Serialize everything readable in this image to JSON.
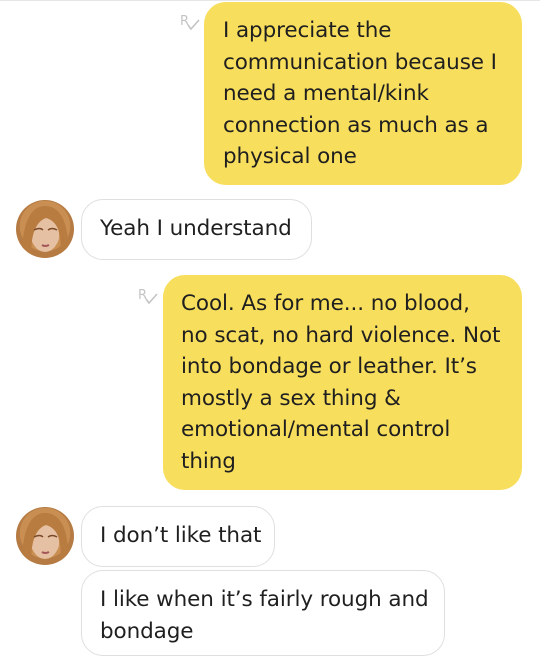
{
  "conversation": {
    "messages": [
      {
        "direction": "outgoing",
        "status": "read",
        "text": "I appreciate the\ncommunication because I\nneed a mental/kink\nconnection as much as a\nphysical one"
      },
      {
        "direction": "incoming",
        "text": "Yeah I understand"
      },
      {
        "direction": "outgoing",
        "status": "read",
        "text": "Cool.  As for me... no blood,\nno scat, no hard violence. Not\ninto bondage or leather. It’s\nmostly a sex thing &\nemotional/mental control\nthing"
      },
      {
        "direction": "incoming",
        "text": "I don’t like that"
      },
      {
        "direction": "incoming",
        "text": "I like when it’s fairly rough and\nbondage"
      }
    ]
  },
  "icons": {
    "read_receipt": "read-receipt-icon",
    "avatar": "contact-avatar"
  },
  "colors": {
    "outgoing_bubble": "#f8de5d",
    "incoming_bubble": "#ffffff",
    "incoming_border": "#dfdfdf",
    "receipt": "#c4c4c4",
    "text": "#1f1f1f"
  }
}
